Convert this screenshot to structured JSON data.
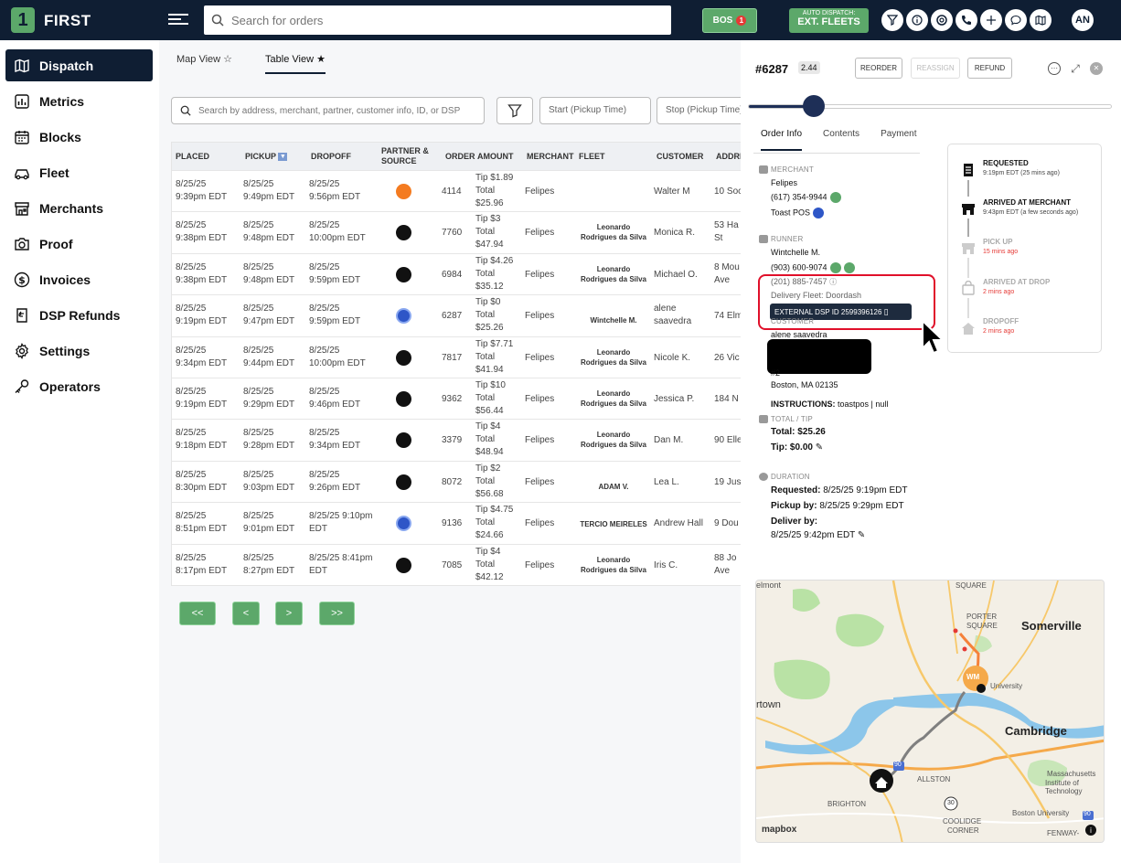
{
  "app": {
    "brand": "FIRST",
    "logo_letter": "1"
  },
  "topbar": {
    "search_placeholder": "Search for orders",
    "bos_label": "BOS",
    "bos_count": "1",
    "auto_dispatch_label": "AUTO DISPATCH:",
    "auto_dispatch_value": "EXT. FLEETS",
    "icons": [
      "filter-icon",
      "info-icon",
      "lifebuoy-icon",
      "phone-icon",
      "plus-icon",
      "chat-icon",
      "map-icon"
    ],
    "user_initials": "AN"
  },
  "sidebar": {
    "items": [
      {
        "label": "Dispatch",
        "icon": "map-icon",
        "active": true
      },
      {
        "label": "Metrics",
        "icon": "chart-icon"
      },
      {
        "label": "Blocks",
        "icon": "calendar-icon"
      },
      {
        "label": "Fleet",
        "icon": "car-icon"
      },
      {
        "label": "Merchants",
        "icon": "store-icon"
      },
      {
        "label": "Proof",
        "icon": "camera-icon"
      },
      {
        "label": "Invoices",
        "icon": "dollar-icon"
      },
      {
        "label": "DSP Refunds",
        "icon": "refund-icon"
      },
      {
        "label": "Settings",
        "icon": "gear-icon"
      },
      {
        "label": "Operators",
        "icon": "key-icon"
      }
    ]
  },
  "main": {
    "tabs": [
      {
        "label": "Map View",
        "star": "☆"
      },
      {
        "label": "Table View",
        "star": "★"
      }
    ],
    "search_placeholder": "Search by address, merchant, partner, customer info, ID, or DSP",
    "start_placeholder": "Start (Pickup Time)",
    "stop_placeholder": "Stop (Pickup Time)",
    "headers": [
      "PLACED",
      "PICKUP",
      "DROPOFF",
      "PARTNER &",
      "SOURCE",
      "ORDER",
      "AMOUNT",
      "MERCHANT",
      "FLEET",
      "CUSTOMER",
      "ADDRESS"
    ],
    "rows": [
      {
        "placed": [
          "8/25/25",
          "9:39pm EDT"
        ],
        "pickup": [
          "8/25/25",
          "9:49pm EDT"
        ],
        "dropoff": [
          "8/25/25",
          "9:56pm EDT"
        ],
        "src": "dd",
        "order": "4114",
        "amount": [
          "Tip $1.89",
          "Total",
          "$25.96"
        ],
        "merchant": "Felipes",
        "fleet": [
          "",
          ""
        ],
        "customer": [
          "Walter M",
          ""
        ],
        "address": [
          "10 Soc",
          ""
        ]
      },
      {
        "placed": [
          "8/25/25",
          "9:38pm EDT"
        ],
        "pickup": [
          "8/25/25",
          "9:48pm EDT"
        ],
        "dropoff": [
          "8/25/25",
          "10:00pm EDT"
        ],
        "src": "ue",
        "order": "7760",
        "amount": [
          "Tip $3",
          "Total",
          "$47.94"
        ],
        "merchant": "Felipes",
        "fleet": [
          "Leonardo",
          "Rodrigues da Silva"
        ],
        "customer": [
          "Monica R.",
          ""
        ],
        "address": [
          "53 Ha",
          "St"
        ]
      },
      {
        "placed": [
          "8/25/25",
          "9:38pm EDT"
        ],
        "pickup": [
          "8/25/25",
          "9:48pm EDT"
        ],
        "dropoff": [
          "8/25/25",
          "9:59pm EDT"
        ],
        "src": "ue",
        "order": "6984",
        "amount": [
          "Tip $4.26",
          "Total",
          "$35.12"
        ],
        "merchant": "Felipes",
        "fleet": [
          "Leonardo",
          "Rodrigues da Silva"
        ],
        "customer": [
          "Michael O.",
          ""
        ],
        "address": [
          "8 Mou",
          "Ave"
        ]
      },
      {
        "placed": [
          "8/25/25",
          "9:19pm EDT"
        ],
        "pickup": [
          "8/25/25",
          "9:47pm EDT"
        ],
        "dropoff": [
          "8/25/25",
          "9:59pm EDT"
        ],
        "src": "bl",
        "order": "6287",
        "amount": [
          "Tip $0",
          "Total",
          "$25.26"
        ],
        "merchant": "Felipes",
        "fleet": [
          "",
          "Wintchelle M."
        ],
        "customer": [
          "alene",
          "saavedra"
        ],
        "address": [
          "74 Elm",
          ""
        ]
      },
      {
        "placed": [
          "8/25/25",
          "9:34pm EDT"
        ],
        "pickup": [
          "8/25/25",
          "9:44pm EDT"
        ],
        "dropoff": [
          "8/25/25",
          "10:00pm EDT"
        ],
        "src": "ue",
        "order": "7817",
        "amount": [
          "Tip $7.71",
          "Total",
          "$41.94"
        ],
        "merchant": "Felipes",
        "fleet": [
          "Leonardo",
          "Rodrigues da Silva"
        ],
        "customer": [
          "Nicole K.",
          ""
        ],
        "address": [
          "26 Vic",
          ""
        ]
      },
      {
        "placed": [
          "8/25/25",
          "9:19pm EDT"
        ],
        "pickup": [
          "8/25/25",
          "9:29pm EDT"
        ],
        "dropoff": [
          "8/25/25",
          "9:46pm EDT"
        ],
        "src": "ue",
        "order": "9362",
        "amount": [
          "Tip $10",
          "Total",
          "$56.44"
        ],
        "merchant": "Felipes",
        "fleet": [
          "Leonardo",
          "Rodrigues da Silva"
        ],
        "customer": [
          "Jessica P.",
          ""
        ],
        "address": [
          "184 N",
          ""
        ]
      },
      {
        "placed": [
          "8/25/25",
          "9:18pm EDT"
        ],
        "pickup": [
          "8/25/25",
          "9:28pm EDT"
        ],
        "dropoff": [
          "8/25/25",
          "9:34pm EDT"
        ],
        "src": "ue",
        "order": "3379",
        "amount": [
          "Tip $4",
          "Total",
          "$48.94"
        ],
        "merchant": "Felipes",
        "fleet": [
          "Leonardo",
          "Rodrigues da Silva"
        ],
        "customer": [
          "Dan M.",
          ""
        ],
        "address": [
          "90 Elle",
          ""
        ]
      },
      {
        "placed": [
          "8/25/25",
          "8:30pm EDT"
        ],
        "pickup": [
          "8/25/25",
          "9:03pm EDT"
        ],
        "dropoff": [
          "8/25/25",
          "9:26pm EDT"
        ],
        "src": "ue",
        "order": "8072",
        "amount": [
          "Tip $2",
          "Total",
          "$56.68"
        ],
        "merchant": "Felipes",
        "fleet": [
          "",
          "ADAM V."
        ],
        "customer": [
          "Lea L.",
          ""
        ],
        "address": [
          "19 Jus",
          ""
        ]
      },
      {
        "placed": [
          "8/25/25",
          "8:51pm EDT"
        ],
        "pickup": [
          "8/25/25",
          "9:01pm EDT"
        ],
        "dropoff": [
          "8/25/25 9:10pm",
          "EDT"
        ],
        "src": "bl",
        "order": "9136",
        "amount": [
          "Tip $4.75",
          "Total",
          "$24.66"
        ],
        "merchant": "Felipes",
        "fleet": [
          "TERCIO MEIRELES",
          ""
        ],
        "customer": [
          "Andrew Hall",
          ""
        ],
        "address": [
          "9 Dou",
          ""
        ]
      },
      {
        "placed": [
          "8/25/25",
          "8:17pm EDT"
        ],
        "pickup": [
          "8/25/25",
          "8:27pm EDT"
        ],
        "dropoff": [
          "8/25/25 8:41pm",
          "EDT"
        ],
        "src": "ue",
        "order": "7085",
        "amount": [
          "Tip $4",
          "Total",
          "$42.12"
        ],
        "merchant": "Felipes",
        "fleet": [
          "Leonardo",
          "Rodrigues da Silva"
        ],
        "customer": [
          "Iris C.",
          ""
        ],
        "address": [
          "88 Jo",
          "Ave"
        ]
      }
    ],
    "pager": [
      "<<",
      "<",
      ">",
      ">>"
    ]
  },
  "panel": {
    "order_id": "#6287",
    "order_tag": "2.44",
    "reorder": "REORDER",
    "reassign": "REASSIGN",
    "refund": "REFUND",
    "progress": 0.18,
    "tabs": [
      "Order Info",
      "Contents",
      "Payment"
    ],
    "merchant_label": "MERCHANT",
    "merchant_name": "Felipes",
    "merchant_phone": "(617) 354-9944",
    "merchant_pos": "Toast POS",
    "runner_label": "RUNNER",
    "runner_name": "Wintchelle M.",
    "runner_phone": "(903) 600-9074",
    "runner_phone2": "(201) 885-7457",
    "delivery_fleet": "Delivery Fleet: Doordash",
    "ext_dsp": "EXTERNAL DSP ID 2599396126",
    "customer_label": "CUSTOMER",
    "customer_name": "alene saavedra",
    "customer_addr2": "#2",
    "customer_city": "Boston, MA 02135",
    "instructions_label": "INSTRUCTIONS:",
    "instructions": "toastpos | null",
    "total_label": "TOTAL / TIP",
    "total": "Total: $25.26",
    "tip": "Tip: $0.00",
    "duration_label": "DURATION",
    "requested": "Requested:",
    "requested_v": "8/25/25 9:19pm EDT",
    "pickup_by": "Pickup by:",
    "pickup_by_v": "8/25/25 9:29pm EDT",
    "deliver_by": "Deliver by:",
    "deliver_by_v": "8/25/25 9:42pm EDT",
    "timeline": [
      {
        "title": "REQUESTED",
        "sub": "9:19pm EDT (25 mins ago)"
      },
      {
        "title": "ARRIVED AT MERCHANT",
        "sub": "9:43pm EDT (a few seconds ago)"
      },
      {
        "title": "PICK UP",
        "sub": "15 mins ago"
      },
      {
        "title": "ARRIVED AT DROP",
        "sub": "2 mins ago"
      },
      {
        "title": "DROPOFF",
        "sub": "2 mins ago"
      }
    ],
    "map": {
      "labels": [
        "elmont",
        "SQUARE",
        "PORTER",
        "SQUARE",
        "Somerville",
        "rtown",
        "University",
        "Cambridge",
        "ALLSTON",
        "Massachusetts",
        "Institute of Technology",
        "BRIGHTON",
        "Boston University",
        "COOLIDGE",
        "CORNER",
        "FENWAY-",
        "mapbox"
      ],
      "marker_label": "WM",
      "road_labels": [
        "90",
        "30",
        "90"
      ]
    }
  }
}
